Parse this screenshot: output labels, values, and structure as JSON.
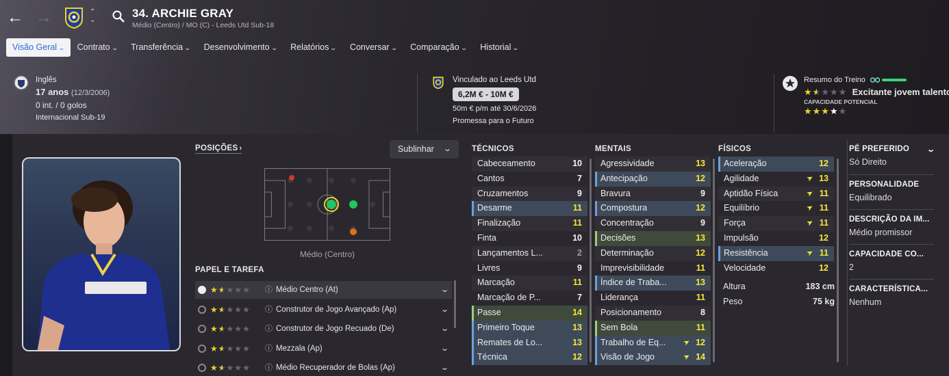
{
  "header": {
    "player_title": "34. ARCHIE GRAY",
    "player_subtitle": "Médio (Centro) / MO (C) - Leeds Utd Sub-18"
  },
  "tabs": [
    {
      "label": "Visão Geral",
      "active": true
    },
    {
      "label": "Contrato"
    },
    {
      "label": "Transferência"
    },
    {
      "label": "Desenvolvimento"
    },
    {
      "label": "Relatórios"
    },
    {
      "label": "Conversar"
    },
    {
      "label": "Comparação"
    },
    {
      "label": "Historial"
    }
  ],
  "bio": {
    "nationality": "Inglês",
    "age": "17 anos",
    "dob": "(12/3/2006)",
    "caps": "0 int. / 0 golos",
    "intl": "Internacional Sub-19"
  },
  "contract": {
    "club": "Vinculado ao Leeds Utd",
    "value": "6,2M € - 10M €",
    "wage": "50m € p/m até 30/6/2026",
    "status": "Promessa para o Futuro"
  },
  "training": {
    "title": "Resumo do Treino",
    "current_rating": 1.5,
    "verdict": "Excitante jovem talento",
    "potential_label": "CAPACIDADE POTENCIAL",
    "potential_rating": 3.5,
    "current_stars": "★★★★★",
    "potential_stars": "★★★★"
  },
  "positions": {
    "label": "POSIÇÕES",
    "highlight_label": "Sublinhar",
    "position_name": "Médio (Centro)"
  },
  "roles": {
    "label": "PAPEL E TAREFA",
    "items": [
      {
        "name": "Médio Centro (At)",
        "rating": 1.5,
        "selected": true
      },
      {
        "name": "Construtor de Jogo Avançado (Ap)",
        "rating": 1.5
      },
      {
        "name": "Construtor de Jogo Recuado (De)",
        "rating": 1.5
      },
      {
        "name": "Mezzala (Ap)",
        "rating": 1.5
      },
      {
        "name": "Médio Recuperador de Bolas (Ap)",
        "rating": 1.5
      }
    ]
  },
  "technical": {
    "label": "TÉCNICOS",
    "rows": [
      {
        "name": "Cabeceamento",
        "value": "10"
      },
      {
        "name": "Cantos",
        "value": "7"
      },
      {
        "name": "Cruzamentos",
        "value": "9"
      },
      {
        "name": "Desarme",
        "value": "11",
        "hl": "b"
      },
      {
        "name": "Finalização",
        "value": "11"
      },
      {
        "name": "Finta",
        "value": "10"
      },
      {
        "name": "Lançamentos L...",
        "value": "2",
        "grey": true
      },
      {
        "name": "Livres",
        "value": "9"
      },
      {
        "name": "Marcação",
        "value": "11"
      },
      {
        "name": "Marcação de P...",
        "value": "7"
      },
      {
        "name": "Passe",
        "value": "14",
        "hl": "g"
      },
      {
        "name": "Primeiro Toque",
        "value": "13",
        "hl": "b"
      },
      {
        "name": "Remates de Lo...",
        "value": "13",
        "hl": "b"
      },
      {
        "name": "Técnica",
        "value": "12",
        "hl": "b"
      }
    ]
  },
  "mental": {
    "label": "MENTAIS",
    "rows": [
      {
        "name": "Agressividade",
        "value": "13"
      },
      {
        "name": "Antecipação",
        "value": "12",
        "hl": "b"
      },
      {
        "name": "Bravura",
        "value": "9"
      },
      {
        "name": "Compostura",
        "value": "12",
        "hl": "b"
      },
      {
        "name": "Concentração",
        "value": "9"
      },
      {
        "name": "Decisões",
        "value": "13",
        "hl": "g"
      },
      {
        "name": "Determinação",
        "value": "12"
      },
      {
        "name": "Imprevisibilidade",
        "value": "11"
      },
      {
        "name": "Índice de Traba...",
        "value": "13",
        "hl": "b"
      },
      {
        "name": "Liderança",
        "value": "11"
      },
      {
        "name": "Posicionamento",
        "value": "8"
      },
      {
        "name": "Sem Bola",
        "value": "11",
        "hl": "g"
      },
      {
        "name": "Trabalho de Eq...",
        "value": "12",
        "hl": "b",
        "arrow": true
      },
      {
        "name": "Visão de Jogo",
        "value": "14",
        "hl": "b",
        "arrow": true
      }
    ]
  },
  "physical": {
    "label": "FÍSICOS",
    "rows": [
      {
        "name": "Aceleração",
        "value": "12",
        "hl": "b"
      },
      {
        "name": "Agilidade",
        "value": "13",
        "arrow": true
      },
      {
        "name": "Aptidão Física",
        "value": "11",
        "arrow": true
      },
      {
        "name": "Equilíbrio",
        "value": "11",
        "arrow": true
      },
      {
        "name": "Força",
        "value": "11",
        "arrow": true
      },
      {
        "name": "Impulsão",
        "value": "12"
      },
      {
        "name": "Resistência",
        "value": "11",
        "hl": "b",
        "arrow": true
      },
      {
        "name": "Velocidade",
        "value": "12"
      }
    ],
    "height_label": "Altura",
    "height": "183 cm",
    "weight_label": "Peso",
    "weight": "75 kg"
  },
  "details": {
    "foot_label": "PÉ PREFERIDO",
    "foot": "Só Direito",
    "personality_label": "PERSONALIDADE",
    "personality": "Equilibrado",
    "media_label": "DESCRIÇÃO DA IM...",
    "media": "Médio promissor",
    "capacity_label": "CAPACIDADE CO...",
    "capacity": "2",
    "traits_label": "CARACTERÍSTICA...",
    "traits": "Nenhum"
  },
  "colors": {
    "accent": "#f6e83a",
    "tab_active": "#2c6bd6",
    "highlight_blue": "#3e4a5a",
    "highlight_green": "#3f4a3c"
  }
}
